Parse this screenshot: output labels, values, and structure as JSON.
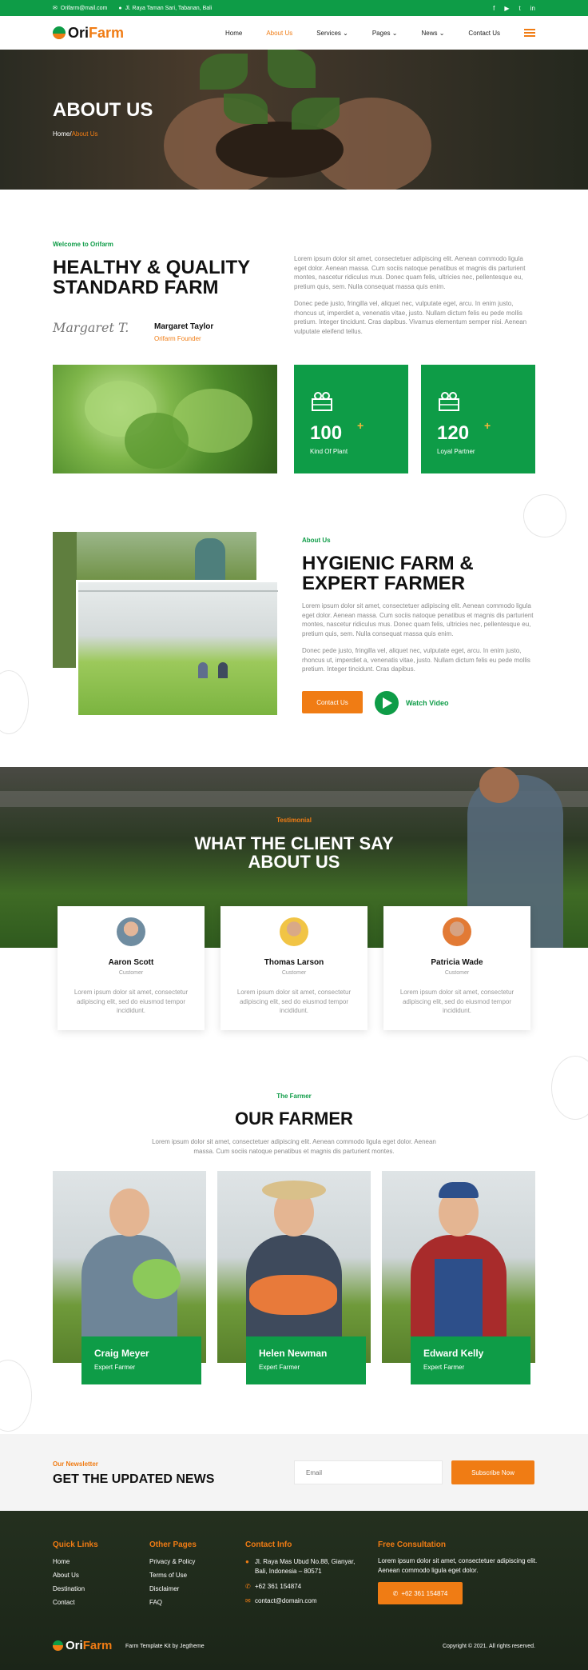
{
  "topbar": {
    "email": "Orifarm@mail.com",
    "address": "Jl. Raya Taman Sari, Tabanan, Bali",
    "social": [
      "f",
      "▶",
      "t",
      "in"
    ]
  },
  "nav": {
    "logo_part1": "Ori",
    "logo_part2": "Farm",
    "items": [
      "Home",
      "About Us",
      "Services",
      "Pages",
      "News",
      "Contact Us"
    ]
  },
  "hero": {
    "title": "ABOUT US",
    "crumb_home": "Home/",
    "crumb_current": "About Us"
  },
  "intro": {
    "eyebrow": "Welcome to Orifarm",
    "title_line1": "HEALTHY & QUALITY",
    "title_line2": "STANDARD FARM",
    "para1": "Lorem ipsum dolor sit amet, consectetuer adipiscing elit. Aenean commodo ligula eget dolor. Aenean massa. Cum sociis natoque penatibus et magnis dis parturient montes, nascetur ridiculus mus. Donec quam felis, ultricies nec, pellentesque eu, pretium quis, sem. Nulla consequat massa quis enim.",
    "para2": "Donec pede justo, fringilla vel, aliquet nec, vulputate eget, arcu. In enim justo, rhoncus ut, imperdiet a, venenatis vitae, justo. Nullam dictum felis eu pede mollis pretium. Integer tincidunt. Cras dapibus. Vivamus elementum semper nisi. Aenean vulputate eleifend tellus.",
    "signature": "Margaret T.",
    "founder_name": "Margaret Taylor",
    "founder_role": "Orifarm Founder",
    "stats": [
      {
        "value": "100",
        "plus": "+",
        "label": "Kind Of Plant"
      },
      {
        "value": "120",
        "plus": "+",
        "label": "Loyal Partner"
      }
    ]
  },
  "about": {
    "eyebrow": "About Us",
    "title_line1": "HYGIENIC FARM &",
    "title_line2": "EXPERT FARMER",
    "para1": "Lorem ipsum dolor sit amet, consectetuer adipiscing elit. Aenean commodo ligula eget dolor. Aenean massa. Cum sociis natoque penatibus et magnis dis parturient montes, nascetur ridiculus mus. Donec quam felis, ultricies nec, pellentesque eu, pretium quis, sem. Nulla consequat massa quis enim.",
    "para2": "Donec pede justo, fringilla vel, aliquet nec, vulputate eget, arcu. In enim justo, rhoncus ut, imperdiet a, venenatis vitae, justo. Nullam dictum felis eu pede mollis pretium. Integer tincidunt. Cras dapibus.",
    "contact_btn": "Contact Us",
    "video_label": "Watch Video"
  },
  "testimonial": {
    "eyebrow": "Testimonial",
    "title_line1": "WHAT THE CLIENT SAY",
    "title_line2": "ABOUT US",
    "items": [
      {
        "name": "Aaron Scott",
        "role": "Customer",
        "text": "Lorem ipsum dolor sit amet, consectetur adipiscing elit, sed do eiusmod tempor incididunt."
      },
      {
        "name": "Thomas Larson",
        "role": "Customer",
        "text": "Lorem ipsum dolor sit amet, consectetur adipiscing elit, sed do eiusmod tempor incididunt."
      },
      {
        "name": "Patricia Wade",
        "role": "Customer",
        "text": "Lorem ipsum dolor sit amet, consectetur adipiscing elit, sed do eiusmod tempor incididunt."
      }
    ]
  },
  "farmer": {
    "eyebrow": "The Farmer",
    "title": "OUR FARMER",
    "desc": "Lorem ipsum dolor sit amet, consectetuer adipiscing elit. Aenean commodo ligula eget dolor. Aenean massa. Cum sociis natoque penatibus et magnis dis parturient montes.",
    "items": [
      {
        "name": "Craig Meyer",
        "role": "Expert Farmer"
      },
      {
        "name": "Helen Newman",
        "role": "Expert Farmer"
      },
      {
        "name": "Edward Kelly",
        "role": "Expert Farmer"
      }
    ]
  },
  "newsletter": {
    "eyebrow": "Our Newsletter",
    "title": "GET THE UPDATED NEWS",
    "email_placeholder": "Email",
    "subscribe_btn": "Subscribe Now"
  },
  "footer": {
    "quick_title": "Quick Links",
    "quick_links": [
      "Home",
      "About Us",
      "Destination",
      "Contact"
    ],
    "other_title": "Other Pages",
    "other_links": [
      "Privacy & Policy",
      "Terms of Use",
      "Disclaimer",
      "FAQ"
    ],
    "contact_title": "Contact Info",
    "address_line1": "Jl. Raya Mas Ubud No.88, Gianyar,",
    "address_line2": "Bali, Indonesia – 80571",
    "phone": "+62 361 154874",
    "email": "contact@domain.com",
    "consult_title": "Free Consultation",
    "consult_text": "Lorem ipsum dolor sit amet, consectetuer adipiscing elit. Aenean commodo ligula eget dolor.",
    "consult_btn": "+62 361 154874",
    "credit": "Farm Template Kit by Jegtheme",
    "copyright": "Copyright © 2021. All rights reserved."
  },
  "colors": {
    "green": "#0e9c47",
    "orange": "#f07c14"
  }
}
